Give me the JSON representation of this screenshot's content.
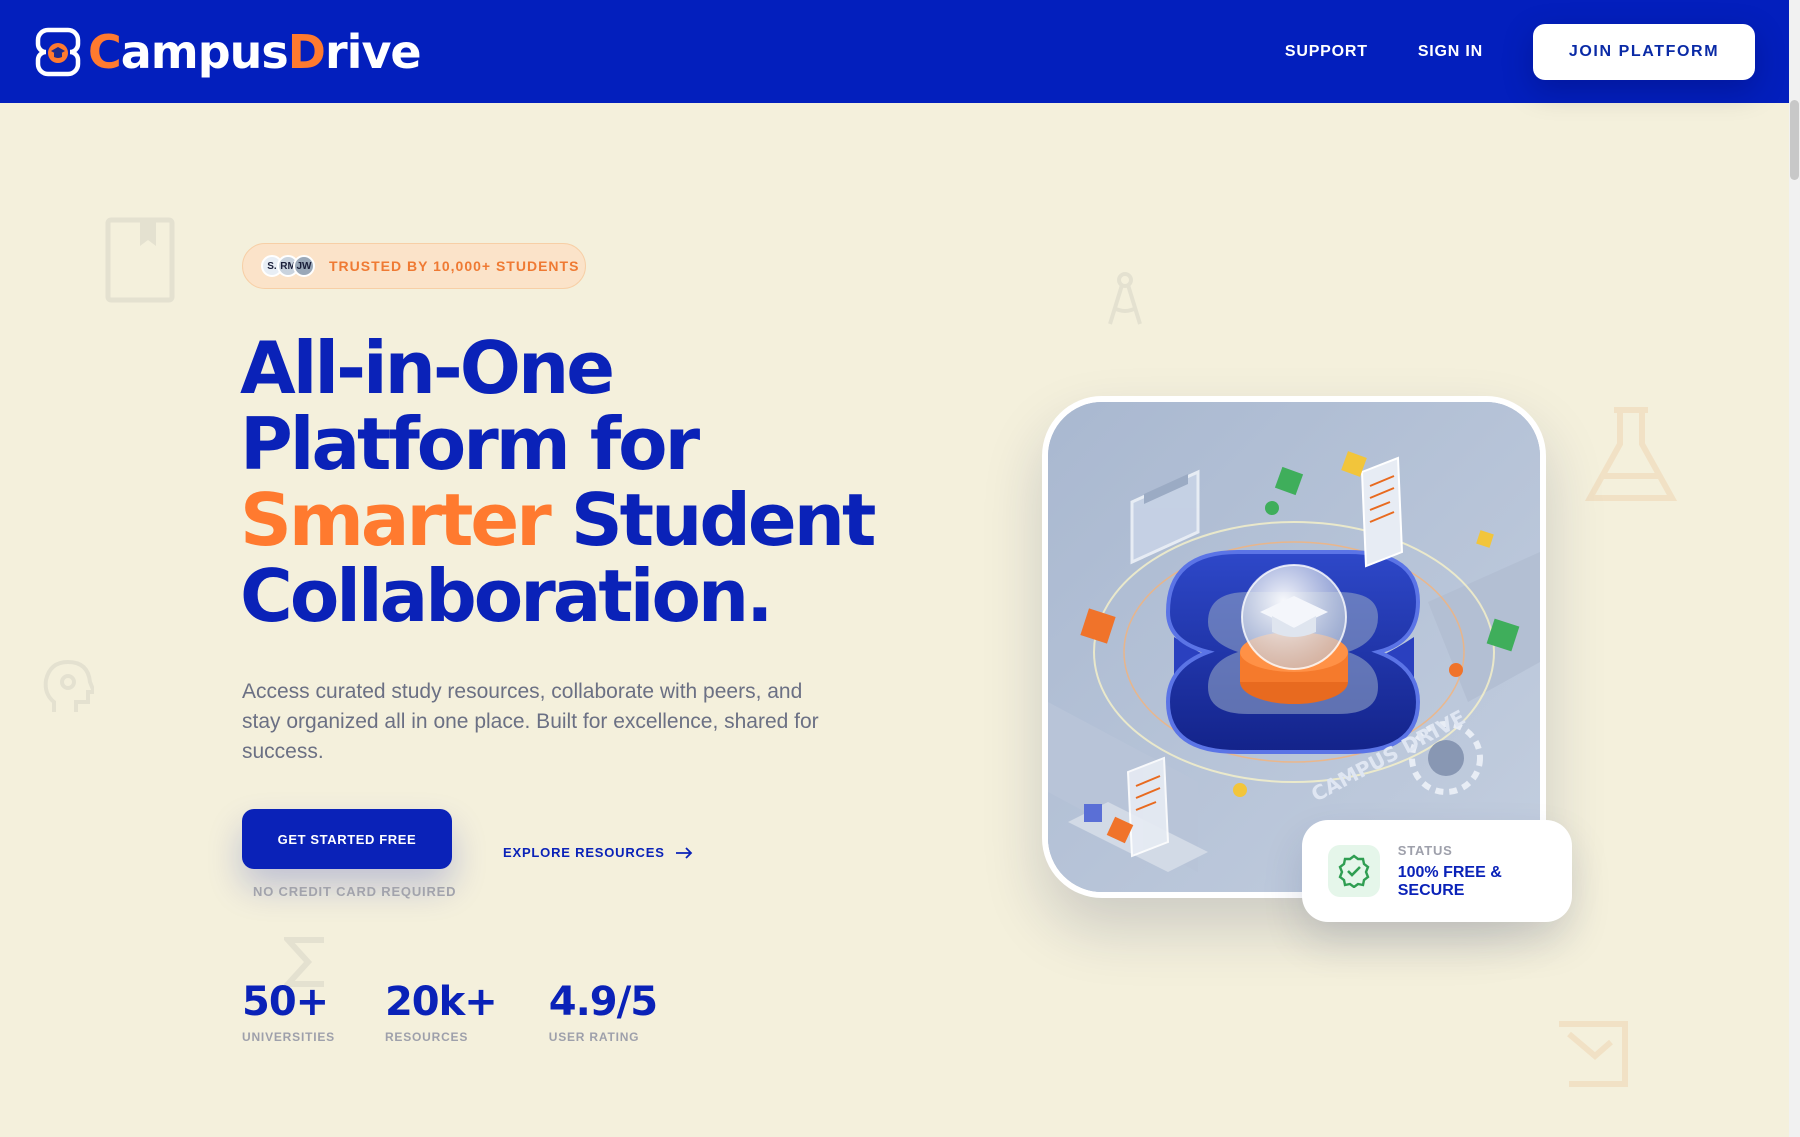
{
  "brand": {
    "name_part1": "Campus",
    "name_part2": "Drive",
    "accent_color": "#ff7a2f",
    "primary_color": "#031fbd"
  },
  "nav": {
    "links": [
      "SUPPORT",
      "SIGN IN"
    ],
    "join_label": "JOIN PLATFORM"
  },
  "hero": {
    "trust_avatars": [
      "S.",
      "RM",
      "JW"
    ],
    "trust_text": "TRUSTED BY 10,000+ STUDENTS",
    "headline_line1": "All-in-One",
    "headline_line2": "Platform for",
    "headline_accent": "Smarter",
    "headline_line3_rest": "Student",
    "headline_line4": "Collaboration.",
    "description": "Access curated study resources, collaborate with peers, and stay organized all in one place. Built for excellence, shared for success.",
    "cta_label": "GET STARTED FREE",
    "cta_note": "NO CREDIT CARD REQUIRED",
    "explore_label": "EXPLORE RESOURCES"
  },
  "stats": [
    {
      "value": "50+",
      "label": "UNIVERSITIES"
    },
    {
      "value": "20k+",
      "label": "RESOURCES"
    },
    {
      "value": "4.9/5",
      "label": "USER RATING"
    }
  ],
  "illustration": {
    "engraved_text": "CAMPUS DRIVE",
    "icon": "isometric-campus-logo-illustration"
  },
  "status_card": {
    "label": "STATUS",
    "value": "100% FREE & SECURE",
    "icon": "verified-badge-icon"
  }
}
